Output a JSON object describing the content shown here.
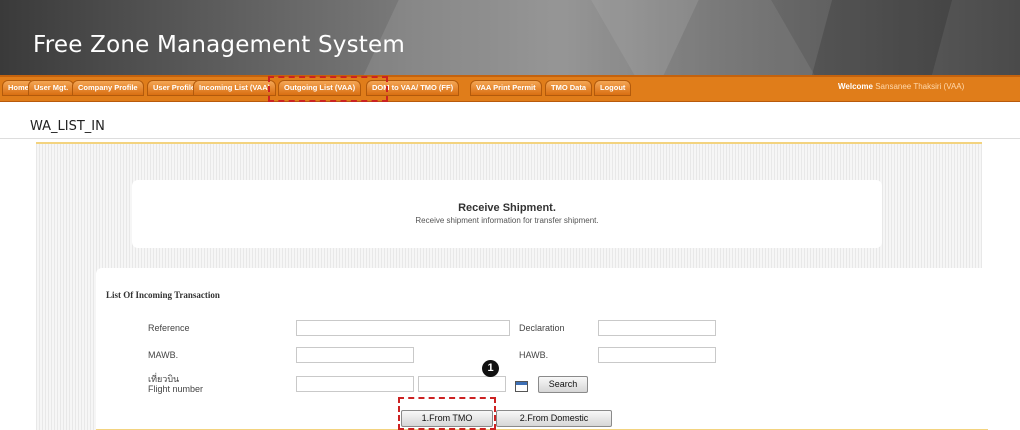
{
  "app": {
    "title": "Free Zone Management System"
  },
  "nav": {
    "items": [
      "Home",
      "User Mgt.",
      "Company Profile",
      "User Profile",
      "Incoming List (VAA)",
      "Outgoing List (VAA)",
      "DOM to VAA/ TMO (FF)",
      "VAA Print Permit",
      "TMO Data",
      "Logout"
    ],
    "welcome_label": "Welcome",
    "welcome_user": "Sansanee Thaksiri (VAA)"
  },
  "page": {
    "id": "WA_LIST_IN"
  },
  "receive": {
    "title": "Receive Shipment.",
    "subtitle": "Receive shipment information for transfer shipment."
  },
  "list": {
    "title": "List Of Incoming Transaction",
    "fields": {
      "reference_label": "Reference",
      "declaration_label": "Declaration",
      "mawb_label": "MAWB.",
      "hawb_label": "HAWB.",
      "flight_label_th": "เที่ยวบิน",
      "flight_label_en": "Flight number"
    },
    "search_button": "Search",
    "from_tmo_button": "1.From TMO",
    "from_domestic_button": "2.From Domestic"
  },
  "annotation": {
    "marker": "1"
  },
  "colors": {
    "nav_orange": "#e07d1a",
    "callout_red": "#cc2222",
    "panel_border": "#f3d37f"
  }
}
